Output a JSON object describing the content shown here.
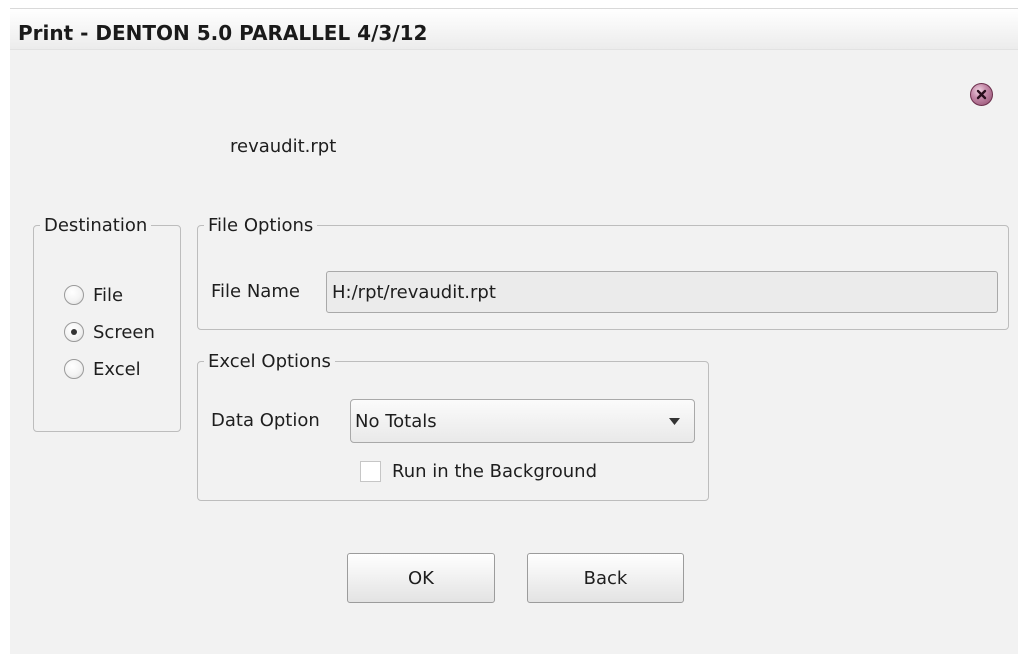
{
  "window": {
    "title": "Print - DENTON 5.0 PARALLEL 4/3/12",
    "close_icon": "close-icon",
    "accent_close": "#a86588"
  },
  "report": {
    "name": "revaudit.rpt"
  },
  "destination": {
    "legend": "Destination",
    "options": [
      {
        "label": "File",
        "selected": false
      },
      {
        "label": "Screen",
        "selected": true
      },
      {
        "label": "Excel",
        "selected": false
      }
    ]
  },
  "file_options": {
    "legend": "File Options",
    "file_name_label": "File Name",
    "file_name_value": "H:/rpt/revaudit.rpt"
  },
  "excel_options": {
    "legend": "Excel Options",
    "data_option_label": "Data Option",
    "data_option_value": "No Totals",
    "run_background_label": "Run in the Background",
    "run_background_checked": false
  },
  "buttons": {
    "ok": "OK",
    "back": "Back"
  }
}
